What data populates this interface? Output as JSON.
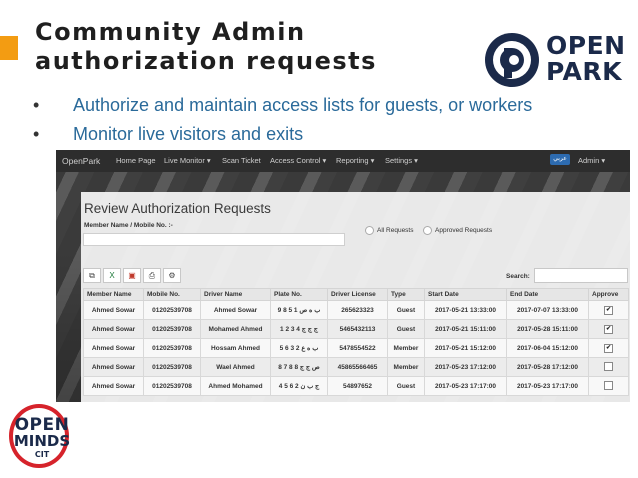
{
  "slide": {
    "title_line1": "Community Admin",
    "title_line2": "authorization requests",
    "bullets": [
      "Authorize and maintain access lists for guests, or workers",
      "Monitor live visitors and exits"
    ],
    "bullet_marker": "•"
  },
  "logos": {
    "open_park": {
      "line1": "OPEN",
      "line2": "PARK",
      "color": "#1b2a4a"
    },
    "open_minds": {
      "line1": "OPEN",
      "line2": "MINDS",
      "line3": "CIT",
      "ring_color": "#d6232b"
    }
  },
  "navbar": {
    "brand": "OpenPark",
    "items": [
      "Home Page",
      "Live Monitor ▾",
      "Scan Ticket",
      "Access Control ▾",
      "Reporting ▾",
      "Settings ▾"
    ],
    "lang_button": "عربي",
    "user_menu": "Admin ▾"
  },
  "review": {
    "title": "Review Authorization Requests",
    "member_label": "Member Name / Mobile No. :-",
    "member_value": "",
    "filter_all": "All Requests",
    "filter_approved": "Approved Requests",
    "search_label": "Search:",
    "search_value": "",
    "toolbar_icons": [
      "copy-icon",
      "excel-icon",
      "pdf-icon",
      "print-icon",
      "columns-icon"
    ],
    "columns": [
      "Member Name",
      "Mobile No.",
      "Driver Name",
      "Plate No.",
      "Driver License",
      "Type",
      "Start Date",
      "End Date",
      "Approve"
    ],
    "rows": [
      {
        "member": "Ahmed Sowar",
        "mobile": "01202539708",
        "driver": "Ahmed Sowar",
        "plate": "9 8 5 1 ب ه ص",
        "license": "265623323",
        "type": "Guest",
        "start": "2017-05-21 13:33:00",
        "end": "2017-07-07 13:33:00",
        "approved": true
      },
      {
        "member": "Ahmed Sowar",
        "mobile": "01202539708",
        "driver": "Mohamed Ahmed",
        "plate": "1 2 3 4 ج ج ج",
        "license": "5465432113",
        "type": "Guest",
        "start": "2017-05-21 15:11:00",
        "end": "2017-05-28 15:11:00",
        "approved": true
      },
      {
        "member": "Ahmed Sowar",
        "mobile": "01202539708",
        "driver": "Hossam Ahmed",
        "plate": "5 6 3 2 ب ه ع",
        "license": "5478554522",
        "type": "Member",
        "start": "2017-05-21 15:12:00",
        "end": "2017-06-04 15:12:00",
        "approved": true
      },
      {
        "member": "Ahmed Sowar",
        "mobile": "01202539708",
        "driver": "Wael Ahmed",
        "plate": "8 7 8 8 ص ج ج",
        "license": "45865566465",
        "type": "Member",
        "start": "2017-05-23 17:12:00",
        "end": "2017-05-28 17:12:00",
        "approved": false
      },
      {
        "member": "Ahmed Sowar",
        "mobile": "01202539708",
        "driver": "Ahmed Mohamed",
        "plate": "4 5 6 2 ج ب ن",
        "license": "54897652",
        "type": "Guest",
        "start": "2017-05-23 17:17:00",
        "end": "2017-05-23 17:17:00",
        "approved": false
      }
    ]
  }
}
